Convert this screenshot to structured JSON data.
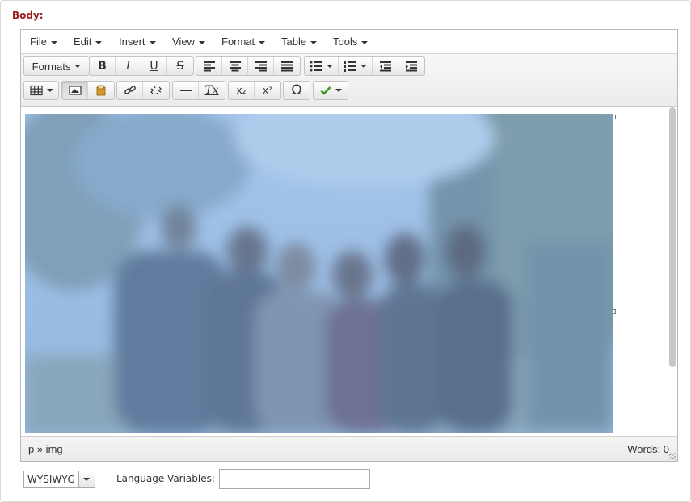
{
  "field": {
    "label": "Body:"
  },
  "menubar": {
    "items": [
      {
        "label": "File"
      },
      {
        "label": "Edit"
      },
      {
        "label": "Insert"
      },
      {
        "label": "View"
      },
      {
        "label": "Format"
      },
      {
        "label": "Table"
      },
      {
        "label": "Tools"
      }
    ]
  },
  "toolbar": {
    "formats_label": "Formats",
    "bold": "B",
    "italic": "I",
    "underline": "U",
    "strikethrough": "S",
    "subscript": "x₂",
    "superscript": "x²",
    "special_char": "Ω",
    "clear_format": "Tx"
  },
  "statusbar": {
    "path": "p » img",
    "word_count": "Words: 0"
  },
  "footer": {
    "mode_value": "WYSIWYG",
    "language_label": "Language Variables:",
    "language_value": ""
  },
  "colors": {
    "label_red": "#9b1c1c",
    "photo_tint": "#9ec0e6",
    "check_green": "#3c9a1e"
  }
}
